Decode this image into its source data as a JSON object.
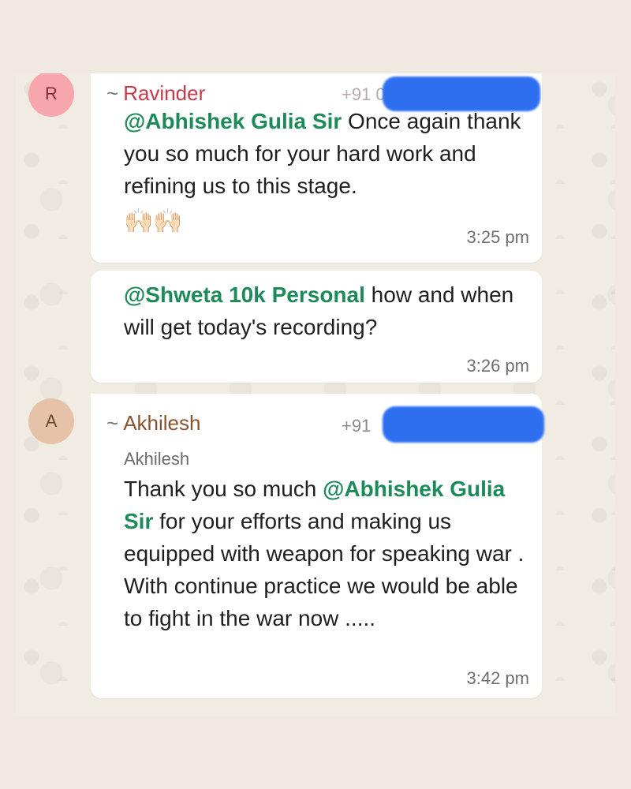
{
  "messages": [
    {
      "avatar_letter": "R",
      "sender": "Ravinder",
      "sender_prefix": "~",
      "phone": "+91 07",
      "mention": "@Abhishek Gulia Sir",
      "text": " Once again thank you so much for your hard work and refining us to this stage.",
      "emoji": "🙌🏻🙌🏻",
      "time": "3:25 pm"
    },
    {
      "mention": "@Shweta 10k Personal",
      "text": " how and when will get today's recording?",
      "time": "3:26 pm"
    },
    {
      "avatar_letter": "A",
      "sender": "Akhilesh",
      "sender_prefix": "~",
      "phone": "+91",
      "push_name": "Akhilesh",
      "text_before": "Thank you so much ",
      "mention": "@Abhishek Gulia Sir",
      "text_after": " for your efforts and making us equipped with weapon for speaking war .",
      "text_line2": "With continue practice we would be able to fight in the war now .....",
      "time": "3:42 pm"
    }
  ],
  "colors": {
    "mention": "#1d8a5a",
    "sender_ravinder": "#c63a4b",
    "sender_akhilesh": "#8a5330",
    "redaction": "#2e6ff0"
  }
}
